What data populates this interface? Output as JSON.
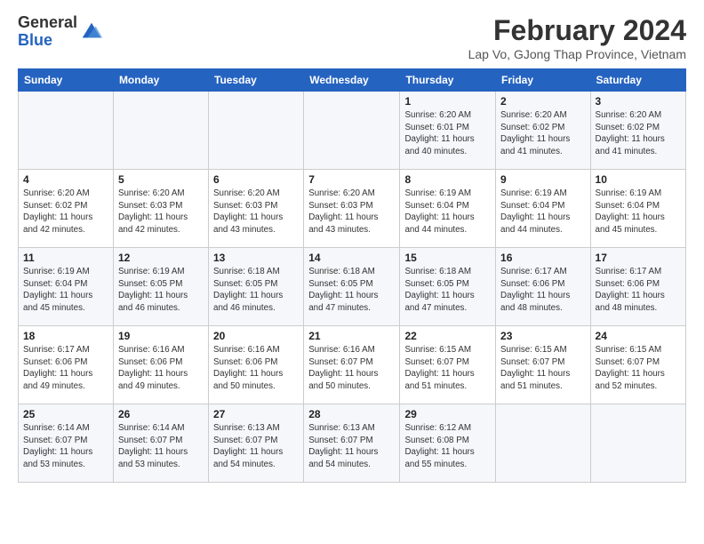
{
  "header": {
    "logo_general": "General",
    "logo_blue": "Blue",
    "month_title": "February 2024",
    "subtitle": "Lap Vo, GJong Thap Province, Vietnam"
  },
  "days_of_week": [
    "Sunday",
    "Monday",
    "Tuesday",
    "Wednesday",
    "Thursday",
    "Friday",
    "Saturday"
  ],
  "weeks": [
    [
      {
        "day": "",
        "info": ""
      },
      {
        "day": "",
        "info": ""
      },
      {
        "day": "",
        "info": ""
      },
      {
        "day": "",
        "info": ""
      },
      {
        "day": "1",
        "info": "Sunrise: 6:20 AM\nSunset: 6:01 PM\nDaylight: 11 hours\nand 40 minutes."
      },
      {
        "day": "2",
        "info": "Sunrise: 6:20 AM\nSunset: 6:02 PM\nDaylight: 11 hours\nand 41 minutes."
      },
      {
        "day": "3",
        "info": "Sunrise: 6:20 AM\nSunset: 6:02 PM\nDaylight: 11 hours\nand 41 minutes."
      }
    ],
    [
      {
        "day": "4",
        "info": "Sunrise: 6:20 AM\nSunset: 6:02 PM\nDaylight: 11 hours\nand 42 minutes."
      },
      {
        "day": "5",
        "info": "Sunrise: 6:20 AM\nSunset: 6:03 PM\nDaylight: 11 hours\nand 42 minutes."
      },
      {
        "day": "6",
        "info": "Sunrise: 6:20 AM\nSunset: 6:03 PM\nDaylight: 11 hours\nand 43 minutes."
      },
      {
        "day": "7",
        "info": "Sunrise: 6:20 AM\nSunset: 6:03 PM\nDaylight: 11 hours\nand 43 minutes."
      },
      {
        "day": "8",
        "info": "Sunrise: 6:19 AM\nSunset: 6:04 PM\nDaylight: 11 hours\nand 44 minutes."
      },
      {
        "day": "9",
        "info": "Sunrise: 6:19 AM\nSunset: 6:04 PM\nDaylight: 11 hours\nand 44 minutes."
      },
      {
        "day": "10",
        "info": "Sunrise: 6:19 AM\nSunset: 6:04 PM\nDaylight: 11 hours\nand 45 minutes."
      }
    ],
    [
      {
        "day": "11",
        "info": "Sunrise: 6:19 AM\nSunset: 6:04 PM\nDaylight: 11 hours\nand 45 minutes."
      },
      {
        "day": "12",
        "info": "Sunrise: 6:19 AM\nSunset: 6:05 PM\nDaylight: 11 hours\nand 46 minutes."
      },
      {
        "day": "13",
        "info": "Sunrise: 6:18 AM\nSunset: 6:05 PM\nDaylight: 11 hours\nand 46 minutes."
      },
      {
        "day": "14",
        "info": "Sunrise: 6:18 AM\nSunset: 6:05 PM\nDaylight: 11 hours\nand 47 minutes."
      },
      {
        "day": "15",
        "info": "Sunrise: 6:18 AM\nSunset: 6:05 PM\nDaylight: 11 hours\nand 47 minutes."
      },
      {
        "day": "16",
        "info": "Sunrise: 6:17 AM\nSunset: 6:06 PM\nDaylight: 11 hours\nand 48 minutes."
      },
      {
        "day": "17",
        "info": "Sunrise: 6:17 AM\nSunset: 6:06 PM\nDaylight: 11 hours\nand 48 minutes."
      }
    ],
    [
      {
        "day": "18",
        "info": "Sunrise: 6:17 AM\nSunset: 6:06 PM\nDaylight: 11 hours\nand 49 minutes."
      },
      {
        "day": "19",
        "info": "Sunrise: 6:16 AM\nSunset: 6:06 PM\nDaylight: 11 hours\nand 49 minutes."
      },
      {
        "day": "20",
        "info": "Sunrise: 6:16 AM\nSunset: 6:06 PM\nDaylight: 11 hours\nand 50 minutes."
      },
      {
        "day": "21",
        "info": "Sunrise: 6:16 AM\nSunset: 6:07 PM\nDaylight: 11 hours\nand 50 minutes."
      },
      {
        "day": "22",
        "info": "Sunrise: 6:15 AM\nSunset: 6:07 PM\nDaylight: 11 hours\nand 51 minutes."
      },
      {
        "day": "23",
        "info": "Sunrise: 6:15 AM\nSunset: 6:07 PM\nDaylight: 11 hours\nand 51 minutes."
      },
      {
        "day": "24",
        "info": "Sunrise: 6:15 AM\nSunset: 6:07 PM\nDaylight: 11 hours\nand 52 minutes."
      }
    ],
    [
      {
        "day": "25",
        "info": "Sunrise: 6:14 AM\nSunset: 6:07 PM\nDaylight: 11 hours\nand 53 minutes."
      },
      {
        "day": "26",
        "info": "Sunrise: 6:14 AM\nSunset: 6:07 PM\nDaylight: 11 hours\nand 53 minutes."
      },
      {
        "day": "27",
        "info": "Sunrise: 6:13 AM\nSunset: 6:07 PM\nDaylight: 11 hours\nand 54 minutes."
      },
      {
        "day": "28",
        "info": "Sunrise: 6:13 AM\nSunset: 6:07 PM\nDaylight: 11 hours\nand 54 minutes."
      },
      {
        "day": "29",
        "info": "Sunrise: 6:12 AM\nSunset: 6:08 PM\nDaylight: 11 hours\nand 55 minutes."
      },
      {
        "day": "",
        "info": ""
      },
      {
        "day": "",
        "info": ""
      }
    ]
  ]
}
